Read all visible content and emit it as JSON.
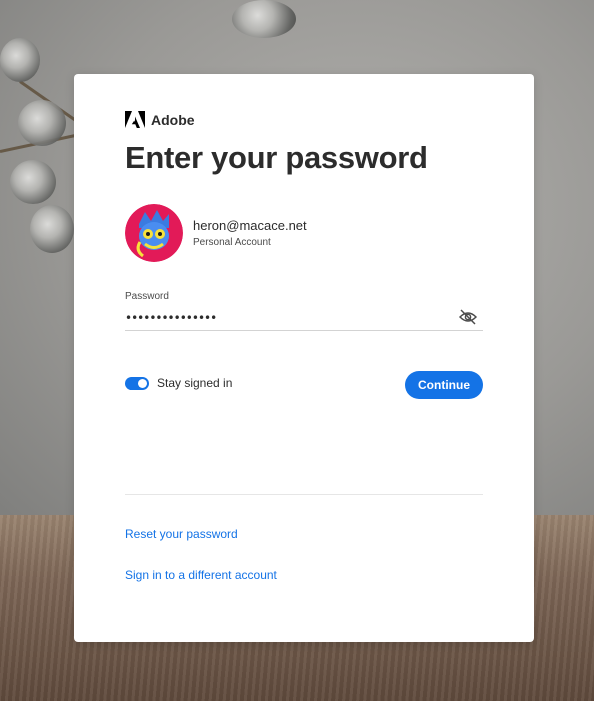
{
  "brand": {
    "name": "Adobe",
    "color": "#000000"
  },
  "page": {
    "title": "Enter your password"
  },
  "account": {
    "email": "heron@macace.net",
    "type": "Personal Account",
    "avatar_bg": "#e21a58"
  },
  "password": {
    "label": "Password",
    "value": "•••••••••••••••",
    "visibility_icon": "eye-hidden-icon"
  },
  "stay_signed_in": {
    "label": "Stay signed in",
    "checked": true
  },
  "actions": {
    "continue_label": "Continue",
    "accent": "#1473e6"
  },
  "links": {
    "reset_password": "Reset your password",
    "different_account": "Sign in to a different account"
  }
}
